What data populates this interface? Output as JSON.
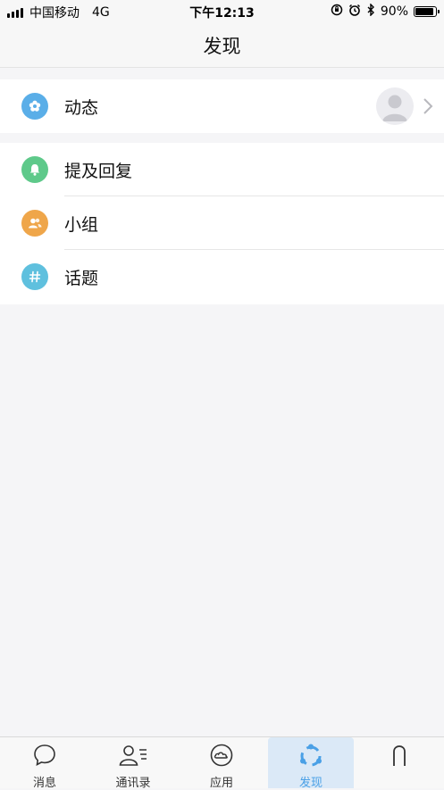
{
  "status_bar": {
    "carrier": "中国移动",
    "network": "4G",
    "time": "下午12:13",
    "battery_text": "90%",
    "battery_level": 0.9
  },
  "nav": {
    "title": "发现"
  },
  "sections": {
    "feed": {
      "label": "动态",
      "icon": "flower-icon",
      "icon_color": "#5aaee8"
    },
    "mentions": {
      "label": "提及回复",
      "icon": "bell-icon",
      "icon_color": "#5ec98a"
    },
    "groups": {
      "label": "小组",
      "icon": "users-icon",
      "icon_color": "#efa64a"
    },
    "topics": {
      "label": "话题",
      "icon": "hashtag-icon",
      "icon_color": "#5fc0de"
    }
  },
  "tabs": [
    {
      "label": "消息",
      "icon": "chat-bubble-icon"
    },
    {
      "label": "通讯录",
      "icon": "contacts-icon"
    },
    {
      "label": "应用",
      "icon": "cloud-app-icon"
    },
    {
      "label": "发现",
      "icon": "discover-icon",
      "active": true
    },
    {
      "label": "",
      "icon": "profile-icon"
    }
  ],
  "colors": {
    "accent": "#4aa0e6",
    "background": "#f5f5f7"
  }
}
